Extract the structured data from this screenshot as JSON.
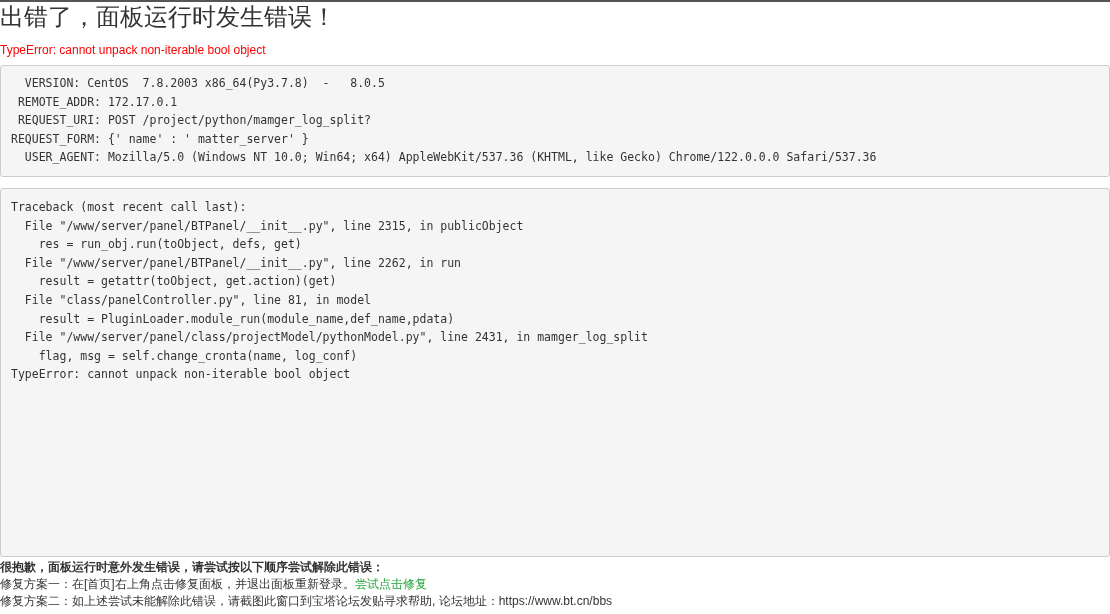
{
  "title": "出错了，面板运行时发生错误！",
  "error_message": "TypeError: cannot unpack non-iterable bool object",
  "environment_lines": [
    "  VERSION: CentOS  7.8.2003 x86_64(Py3.7.8)  -   8.0.5",
    " REMOTE_ADDR: 172.17.0.1",
    " REQUEST_URI: POST /project/python/mamger_log_split?",
    "REQUEST_FORM: {' name' : ' matter_server' }",
    "  USER_AGENT: Mozilla/5.0 (Windows NT 10.0; Win64; x64) AppleWebKit/537.36 (KHTML, like Gecko) Chrome/122.0.0.0 Safari/537.36"
  ],
  "traceback_lines": [
    "Traceback (most recent call last):",
    "  File \"/www/server/panel/BTPanel/__init__.py\", line 2315, in publicObject",
    "    res = run_obj.run(toObject, defs, get)",
    "  File \"/www/server/panel/BTPanel/__init__.py\", line 2262, in run",
    "    result = getattr(toObject, get.action)(get)",
    "  File \"class/panelController.py\", line 81, in model",
    "    result = PluginLoader.module_run(module_name,def_name,pdata)",
    "  File \"/www/server/panel/class/projectModel/pythonModel.py\", line 2431, in mamger_log_split",
    "    flag, msg = self.change_cronta(name, log_conf)",
    "TypeError: cannot unpack non-iterable bool object"
  ],
  "help": {
    "heading": "很抱歉，面板运行时意外发生错误，请尝试按以下顺序尝试解除此错误：",
    "fixes": [
      {
        "text": "修复方案一：在[首页]右上角点击修复面板，并退出面板重新登录。",
        "link": "尝试点击修复"
      },
      {
        "text": "修复方案二：如上述尝试未能解除此错误，请截图此窗口到宝塔论坛发贴寻求帮助, 论坛地址：https://www.bt.cn/bbs"
      }
    ]
  }
}
